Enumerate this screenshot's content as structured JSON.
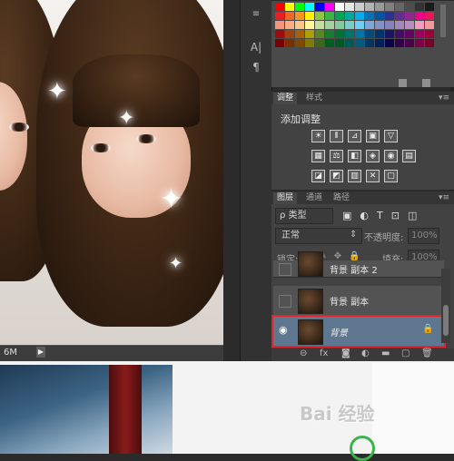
{
  "status": {
    "zoom": "6M",
    "arrow": "▶"
  },
  "toolstrip": {
    "tools": [
      "A|",
      "¶"
    ]
  },
  "swatches": {
    "colors": [
      "#ff0000",
      "#ffff00",
      "#00ff00",
      "#00ffff",
      "#0000ff",
      "#ff00ff",
      "#ffffff",
      "#e6e6e6",
      "#cccccc",
      "#b3b3b3",
      "#999999",
      "#808080",
      "#666666",
      "#4d4d4d",
      "#333333",
      "#1a1a1a",
      "#ed1c24",
      "#f26522",
      "#f7941d",
      "#fff200",
      "#8dc63f",
      "#39b54a",
      "#00a651",
      "#00a99d",
      "#00aeef",
      "#0072bc",
      "#0054a6",
      "#2e3192",
      "#662d91",
      "#92278f",
      "#ec008c",
      "#ed145b",
      "#f69679",
      "#f9ad81",
      "#fdc689",
      "#fff799",
      "#c4df9b",
      "#a3d39c",
      "#82ca9c",
      "#7accc8",
      "#6dcff6",
      "#7da7d9",
      "#8393ca",
      "#8781bd",
      "#a187be",
      "#bd8cbf",
      "#f49ac1",
      "#f5989d",
      "#9e0b0f",
      "#a0410d",
      "#a3620a",
      "#aba000",
      "#598527",
      "#197b30",
      "#007236",
      "#00746b",
      "#0076a3",
      "#004a80",
      "#003471",
      "#1b1464",
      "#440e62",
      "#630460",
      "#9e005d",
      "#9e0039",
      "#790000",
      "#7b2e00",
      "#7d4900",
      "#827b00",
      "#406618",
      "#005e20",
      "#005826",
      "#005952",
      "#005b7f",
      "#003663",
      "#002157",
      "#0d004c",
      "#32004b",
      "#4b0049",
      "#7b0046",
      "#7a0026"
    ]
  },
  "adjustments": {
    "tabs": [
      "调整",
      "样式"
    ],
    "title": "添加调整",
    "row1": [
      "☀",
      "⦀",
      "⊿",
      "▣",
      "▽"
    ],
    "row2": [
      "▦",
      "⚖",
      "◧",
      "◈",
      "◉",
      "▤"
    ],
    "row3": [
      "◪",
      "◩",
      "▥",
      "✕",
      "▢"
    ]
  },
  "layers": {
    "tabs": [
      "图层",
      "通道",
      "路径"
    ],
    "filter_label": "ρ 类型",
    "filter_icons": [
      "▣",
      "◐",
      "T",
      "⊡",
      "◫"
    ],
    "blend_mode": "正常",
    "opacity_label": "不透明度:",
    "opacity_value": "100%",
    "lock_label": "锁定:",
    "lock_icons": [
      "⊠",
      "✎",
      "✥",
      "🔒"
    ],
    "fill_label": "填充:",
    "fill_value": "100%",
    "rows": [
      {
        "name": "背景 副本 2"
      },
      {
        "name": "背景 副本"
      },
      {
        "name": "背景"
      }
    ],
    "footer_icons": [
      "⊖",
      "fx",
      "◙",
      "◐",
      "▬",
      "▢",
      "🗑"
    ]
  },
  "watermark": {
    "text": "Bai 经验"
  }
}
